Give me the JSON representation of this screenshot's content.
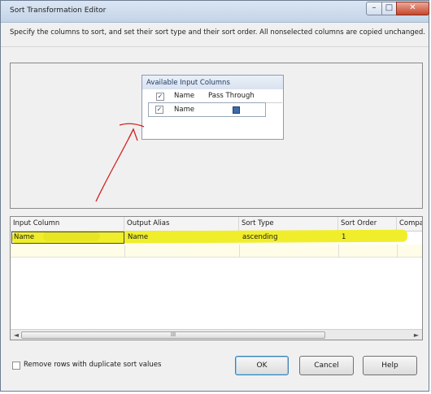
{
  "window": {
    "title": "Sort Transformation Editor",
    "min_label": "–",
    "max_label": "□",
    "close_label": "✕"
  },
  "description": "Specify the columns to sort, and set their sort type and their sort order. All nonselected columns are copied unchanged.",
  "available_columns": {
    "title": "Available Input Columns",
    "headers": {
      "check": "✓",
      "name": "Name",
      "pass_through": "Pass Through"
    },
    "row": {
      "check": "✓",
      "name": "Name"
    }
  },
  "grid": {
    "headers": [
      "Input Column",
      "Output Alias",
      "Sort Type",
      "Sort Order",
      "Compa"
    ],
    "row": {
      "input_column": "Name",
      "output_alias": "Name",
      "sort_type": "ascending",
      "sort_order": "1"
    },
    "scroll_thumb": "III",
    "scroll_left": "◄",
    "scroll_right": "►"
  },
  "options": {
    "remove_duplicates": "Remove rows with duplicate sort values"
  },
  "buttons": {
    "ok": "OK",
    "cancel": "Cancel",
    "help": "Help"
  },
  "colors": {
    "highlight": "#f0ee2a",
    "annotation_arrow": "#d42222"
  }
}
